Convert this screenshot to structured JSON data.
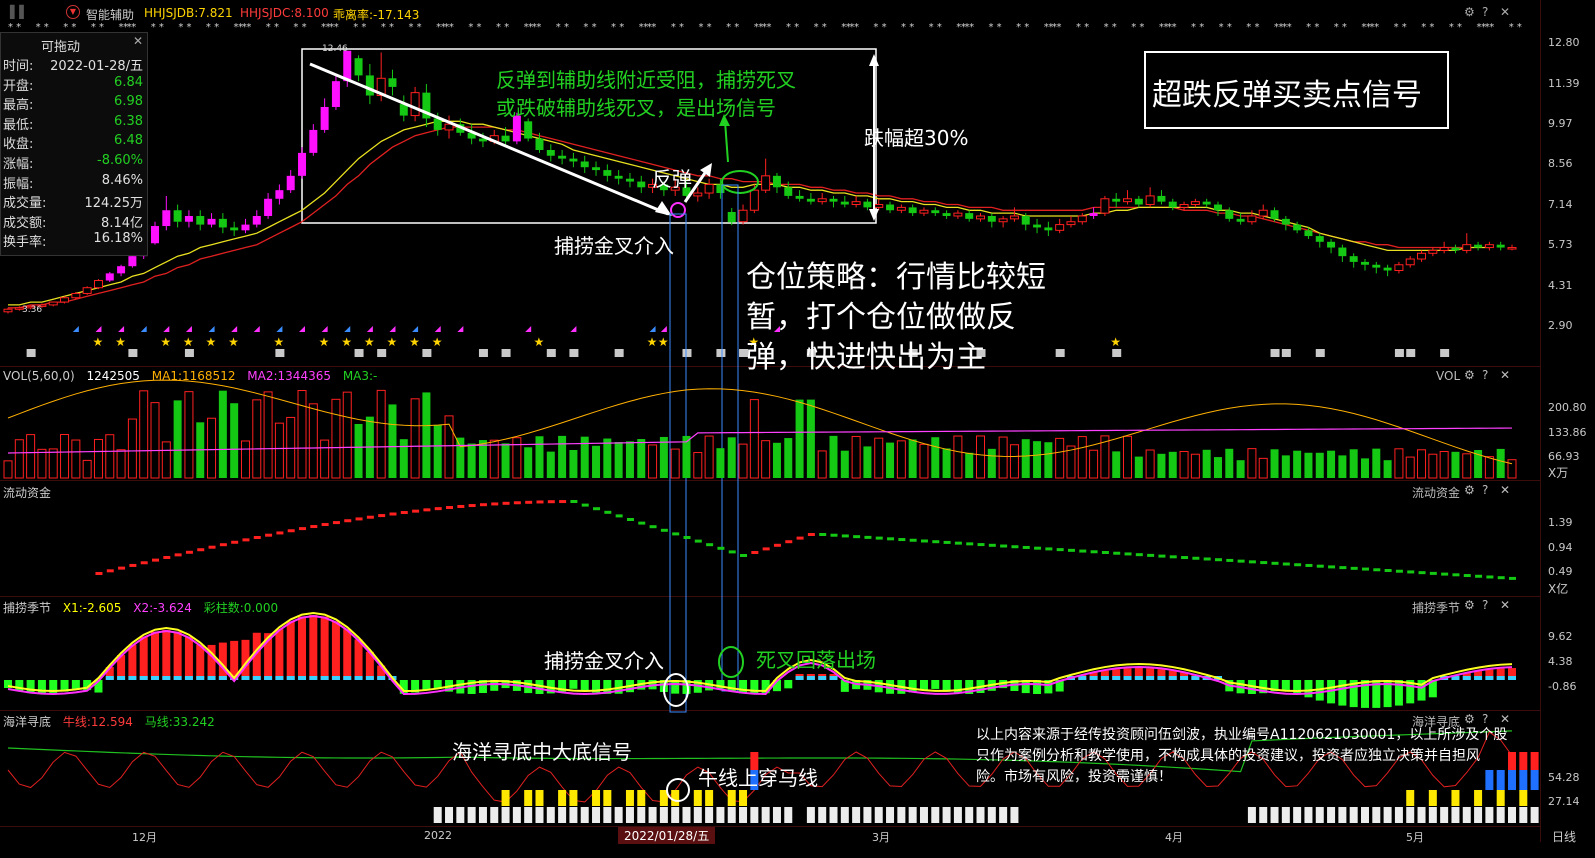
{
  "header": {
    "indicator_name": "智能辅助",
    "line1": "HHJSJDB:7.821",
    "line2": "HHJSJDC:8.100",
    "line3": "乖离率:-17.143",
    "line1_color": "#ffd400",
    "line2_color": "#ff3b3b",
    "line3_color": "#ffd400"
  },
  "info_panel": {
    "title": "可拖动",
    "rows": [
      {
        "label": "时间:",
        "value": "2022-01-28/五",
        "color": "#e0e0e0"
      },
      {
        "label": "开盘:",
        "value": "6.84",
        "color": "#22d022"
      },
      {
        "label": "最高:",
        "value": "6.98",
        "color": "#22d022"
      },
      {
        "label": "最低:",
        "value": "6.38",
        "color": "#22d022"
      },
      {
        "label": "收盘:",
        "value": "6.48",
        "color": "#22d022"
      },
      {
        "label": "涨幅:",
        "value": "-8.60%",
        "color": "#22d022"
      },
      {
        "label": "振幅:",
        "value": "8.46%",
        "color": "#e0e0e0"
      },
      {
        "label": "成交量:",
        "value": "124.25万",
        "color": "#e0e0e0"
      },
      {
        "label": "成交额:",
        "value": "8.14亿",
        "color": "#e0e0e0"
      },
      {
        "label": "换手率:",
        "value": "16.18%",
        "color": "#e0e0e0"
      }
    ]
  },
  "price_axis": [
    "12.80",
    "11.39",
    "9.97",
    "8.56",
    "7.14",
    "5.73",
    "4.31",
    "2.90"
  ],
  "price_marks": {
    "high_label": "12.46",
    "low_label": "3.36"
  },
  "volume_panel": {
    "name": "VOL(5,60,0)",
    "vol": "1242505",
    "ma1": "MA1:1168512",
    "ma2": "MA2:1344365",
    "ma3": "MA3:-",
    "right_title": "VOL",
    "axis": [
      "200.80",
      "133.86",
      "66.93"
    ],
    "unit": "X万"
  },
  "flow_panel": {
    "name": "流动资金",
    "right_title": "流动资金",
    "axis": [
      "1.39",
      "0.94",
      "0.49"
    ],
    "unit": "X亿"
  },
  "catch_panel": {
    "name": "捕捞季节",
    "x1": "X1:-2.605",
    "x2": "X2:-3.624",
    "bars": "彩柱数:0.000",
    "right_title": "捕捞季节",
    "axis": [
      "9.62",
      "4.38",
      "-0.86"
    ]
  },
  "ocean_panel": {
    "name": "海洋寻底",
    "bull": "牛线:12.594",
    "horse": "马线:33.242",
    "right_title": "海洋寻底",
    "axis": [
      "54.28",
      "27.14"
    ]
  },
  "x_axis": {
    "labels": [
      "12月",
      "2022",
      "3月",
      "4月",
      "5月"
    ],
    "cursor_label": "2022/01/28/五",
    "period": "日线"
  },
  "annotations": {
    "title_box": "超跌反弹买卖点信号",
    "resist_line1": "反弹到辅助线附近受阻，捕捞死叉",
    "resist_line2": "或跌破辅助线死叉，是出场信号",
    "drop": "跌幅超30%",
    "rebound": "反弹",
    "enter_main": "捕捞金叉介入",
    "strategy_line1": "仓位策略：行情比较短",
    "strategy_line2": "暂，打个仓位做做反",
    "strategy_line3": "弹，快进快出为主",
    "enter_catch": "捕捞金叉介入",
    "exit_catch": "死叉回落出场",
    "ocean_signal": "海洋寻底中大底信号",
    "bull_cross": "牛线上穿马线",
    "disclaimer_line1": "以上内容来源于经传投资顾问伍剑波，执业编号A1120621030001，以上所涉及个股",
    "disclaimer_line2": "只作为案例分析和教学使用，不构成具体的投资建议，投资者应独立决策并自担风",
    "disclaimer_line3": "险。市场有风险，投资需谨慎！"
  },
  "icons": [
    "settings-icon",
    "help-icon",
    "close-icon"
  ],
  "chart_data": {
    "type": "candlestick",
    "y_range": [
      2.9,
      12.8
    ],
    "candles": [
      {
        "o": 3.36,
        "c": 3.45,
        "h": 3.5,
        "l": 3.3
      },
      {
        "o": 3.45,
        "c": 3.5,
        "h": 3.55,
        "l": 3.4
      },
      {
        "o": 3.5,
        "c": 3.55,
        "h": 3.6,
        "l": 3.45
      },
      {
        "o": 3.55,
        "c": 3.6,
        "h": 3.65,
        "l": 3.5
      },
      {
        "o": 3.6,
        "c": 3.7,
        "h": 3.72,
        "l": 3.55
      },
      {
        "o": 3.7,
        "c": 3.85,
        "h": 3.9,
        "l": 3.65
      },
      {
        "o": 3.85,
        "c": 4.0,
        "h": 4.05,
        "l": 3.8
      },
      {
        "o": 4.0,
        "c": 4.2,
        "h": 4.25,
        "l": 3.95
      },
      {
        "o": 4.2,
        "c": 4.45,
        "h": 4.5,
        "l": 4.15
      },
      {
        "o": 4.45,
        "c": 4.7,
        "h": 4.75,
        "l": 4.4
      },
      {
        "o": 4.7,
        "c": 4.95,
        "h": 5.0,
        "l": 4.6
      },
      {
        "o": 4.95,
        "c": 5.3,
        "h": 5.4,
        "l": 4.9
      },
      {
        "o": 5.3,
        "c": 5.75,
        "h": 5.9,
        "l": 5.2
      },
      {
        "o": 5.75,
        "c": 6.35,
        "h": 6.5,
        "l": 5.7
      },
      {
        "o": 6.35,
        "c": 6.9,
        "h": 7.4,
        "l": 6.2
      },
      {
        "o": 6.9,
        "c": 6.5,
        "h": 7.1,
        "l": 6.3
      },
      {
        "o": 6.5,
        "c": 6.7,
        "h": 6.9,
        "l": 6.3
      },
      {
        "o": 6.7,
        "c": 6.4,
        "h": 6.9,
        "l": 6.2
      },
      {
        "o": 6.4,
        "c": 6.6,
        "h": 6.8,
        "l": 6.3
      },
      {
        "o": 6.6,
        "c": 6.3,
        "h": 6.8,
        "l": 6.1
      },
      {
        "o": 6.3,
        "c": 6.2,
        "h": 6.5,
        "l": 6.0
      },
      {
        "o": 6.2,
        "c": 6.4,
        "h": 6.6,
        "l": 6.1
      },
      {
        "o": 6.4,
        "c": 6.7,
        "h": 6.9,
        "l": 6.3
      },
      {
        "o": 6.7,
        "c": 7.3,
        "h": 7.5,
        "l": 6.6
      },
      {
        "o": 7.3,
        "c": 7.6,
        "h": 7.8,
        "l": 7.1
      },
      {
        "o": 7.6,
        "c": 8.1,
        "h": 8.3,
        "l": 7.5
      },
      {
        "o": 8.1,
        "c": 8.9,
        "h": 9.1,
        "l": 8.0
      },
      {
        "o": 8.9,
        "c": 9.7,
        "h": 9.9,
        "l": 8.8
      },
      {
        "o": 9.7,
        "c": 10.5,
        "h": 10.8,
        "l": 9.6
      },
      {
        "o": 10.5,
        "c": 11.4,
        "h": 11.6,
        "l": 10.4
      },
      {
        "o": 11.4,
        "c": 12.46,
        "h": 12.46,
        "l": 11.2
      },
      {
        "o": 12.2,
        "c": 11.6,
        "h": 12.3,
        "l": 11.4
      },
      {
        "o": 11.6,
        "c": 10.9,
        "h": 12.0,
        "l": 10.6
      },
      {
        "o": 10.9,
        "c": 11.5,
        "h": 12.4,
        "l": 10.7
      },
      {
        "o": 11.5,
        "c": 11.2,
        "h": 11.8,
        "l": 10.9
      },
      {
        "o": 10.6,
        "c": 10.2,
        "h": 10.9,
        "l": 10.0
      },
      {
        "o": 10.2,
        "c": 11.0,
        "h": 11.2,
        "l": 10.0
      },
      {
        "o": 11.0,
        "c": 10.1,
        "h": 11.3,
        "l": 9.8
      },
      {
        "o": 10.1,
        "c": 9.7,
        "h": 10.3,
        "l": 9.5
      },
      {
        "o": 9.7,
        "c": 9.9,
        "h": 10.2,
        "l": 9.4
      },
      {
        "o": 9.9,
        "c": 9.6,
        "h": 10.1,
        "l": 9.5
      },
      {
        "o": 9.6,
        "c": 9.4,
        "h": 9.9,
        "l": 9.2
      },
      {
        "o": 9.4,
        "c": 9.3,
        "h": 9.6,
        "l": 9.1
      },
      {
        "o": 9.3,
        "c": 9.5,
        "h": 9.7,
        "l": 9.2
      },
      {
        "o": 9.5,
        "c": 9.3,
        "h": 9.8,
        "l": 9.1
      },
      {
        "o": 9.3,
        "c": 10.2,
        "h": 10.3,
        "l": 9.2
      },
      {
        "o": 10.0,
        "c": 9.4,
        "h": 10.1,
        "l": 9.3
      },
      {
        "o": 9.4,
        "c": 9.0,
        "h": 9.6,
        "l": 8.9
      },
      {
        "o": 9.0,
        "c": 8.8,
        "h": 9.2,
        "l": 8.6
      },
      {
        "o": 8.8,
        "c": 8.7,
        "h": 9.0,
        "l": 8.5
      },
      {
        "o": 8.7,
        "c": 8.6,
        "h": 8.9,
        "l": 8.4
      },
      {
        "o": 8.6,
        "c": 8.4,
        "h": 8.8,
        "l": 8.2
      },
      {
        "o": 8.4,
        "c": 8.3,
        "h": 8.6,
        "l": 8.1
      },
      {
        "o": 8.3,
        "c": 8.1,
        "h": 8.5,
        "l": 7.9
      },
      {
        "o": 8.1,
        "c": 8.0,
        "h": 8.3,
        "l": 7.8
      },
      {
        "o": 8.0,
        "c": 7.9,
        "h": 8.2,
        "l": 7.7
      },
      {
        "o": 7.9,
        "c": 7.7,
        "h": 8.1,
        "l": 7.5
      },
      {
        "o": 7.7,
        "c": 7.8,
        "h": 8.0,
        "l": 7.5
      },
      {
        "o": 7.8,
        "c": 7.6,
        "h": 7.9,
        "l": 7.4
      },
      {
        "o": 7.6,
        "c": 7.7,
        "h": 8.0,
        "l": 7.4
      },
      {
        "o": 7.7,
        "c": 7.4,
        "h": 7.9,
        "l": 7.2
      },
      {
        "o": 7.4,
        "c": 7.5,
        "h": 7.7,
        "l": 7.2
      },
      {
        "o": 7.5,
        "c": 7.8,
        "h": 8.0,
        "l": 7.3
      },
      {
        "o": 7.8,
        "c": 7.5,
        "h": 8.0,
        "l": 7.3
      },
      {
        "o": 6.84,
        "c": 6.48,
        "h": 6.98,
        "l": 6.38
      },
      {
        "o": 6.5,
        "c": 6.9,
        "h": 7.1,
        "l": 6.4
      },
      {
        "o": 6.9,
        "c": 7.6,
        "h": 7.8,
        "l": 6.8
      },
      {
        "o": 7.6,
        "c": 8.1,
        "h": 8.7,
        "l": 7.5
      },
      {
        "o": 8.1,
        "c": 7.7,
        "h": 8.2,
        "l": 7.5
      },
      {
        "o": 7.7,
        "c": 7.4,
        "h": 7.9,
        "l": 7.3
      },
      {
        "o": 7.4,
        "c": 7.3,
        "h": 7.6,
        "l": 7.2
      },
      {
        "o": 7.3,
        "c": 7.2,
        "h": 7.5,
        "l": 7.1
      },
      {
        "o": 7.2,
        "c": 7.3,
        "h": 7.5,
        "l": 7.1
      },
      {
        "o": 7.3,
        "c": 7.2,
        "h": 7.4,
        "l": 7.0
      },
      {
        "o": 7.2,
        "c": 7.1,
        "h": 7.4,
        "l": 7.0
      },
      {
        "o": 7.1,
        "c": 7.2,
        "h": 7.4,
        "l": 7.0
      },
      {
        "o": 7.2,
        "c": 7.0,
        "h": 7.3,
        "l": 6.9
      },
      {
        "o": 7.0,
        "c": 7.1,
        "h": 7.3,
        "l": 6.9
      },
      {
        "o": 7.1,
        "c": 6.9,
        "h": 7.2,
        "l": 6.8
      },
      {
        "o": 6.9,
        "c": 7.0,
        "h": 7.1,
        "l": 6.8
      },
      {
        "o": 7.0,
        "c": 6.8,
        "h": 7.1,
        "l": 6.7
      },
      {
        "o": 6.8,
        "c": 6.9,
        "h": 7.0,
        "l": 6.7
      },
      {
        "o": 6.9,
        "c": 6.8,
        "h": 7.0,
        "l": 6.7
      },
      {
        "o": 6.8,
        "c": 6.7,
        "h": 6.9,
        "l": 6.6
      },
      {
        "o": 6.7,
        "c": 6.8,
        "h": 6.9,
        "l": 6.6
      },
      {
        "o": 6.8,
        "c": 6.6,
        "h": 6.9,
        "l": 6.5
      },
      {
        "o": 6.6,
        "c": 6.7,
        "h": 6.8,
        "l": 6.5
      },
      {
        "o": 6.7,
        "c": 6.5,
        "h": 6.8,
        "l": 6.3
      },
      {
        "o": 6.5,
        "c": 6.6,
        "h": 6.7,
        "l": 6.3
      },
      {
        "o": 6.6,
        "c": 6.7,
        "h": 7.0,
        "l": 6.5
      },
      {
        "o": 6.7,
        "c": 6.4,
        "h": 6.8,
        "l": 6.2
      },
      {
        "o": 6.4,
        "c": 6.3,
        "h": 6.6,
        "l": 6.1
      },
      {
        "o": 6.3,
        "c": 6.2,
        "h": 6.5,
        "l": 6.0
      },
      {
        "o": 6.2,
        "c": 6.4,
        "h": 6.6,
        "l": 6.1
      },
      {
        "o": 6.4,
        "c": 6.5,
        "h": 6.7,
        "l": 6.3
      },
      {
        "o": 6.5,
        "c": 6.7,
        "h": 6.8,
        "l": 6.4
      },
      {
        "o": 6.7,
        "c": 6.8,
        "h": 7.0,
        "l": 6.6
      },
      {
        "o": 6.8,
        "c": 7.3,
        "h": 7.4,
        "l": 6.7
      },
      {
        "o": 7.3,
        "c": 7.2,
        "h": 7.5,
        "l": 7.0
      },
      {
        "o": 7.2,
        "c": 7.3,
        "h": 7.6,
        "l": 7.1
      },
      {
        "o": 7.3,
        "c": 7.1,
        "h": 7.4,
        "l": 7.0
      },
      {
        "o": 7.1,
        "c": 7.4,
        "h": 7.7,
        "l": 7.0
      },
      {
        "o": 7.4,
        "c": 7.2,
        "h": 7.6,
        "l": 7.1
      },
      {
        "o": 7.2,
        "c": 7.0,
        "h": 7.3,
        "l": 6.9
      },
      {
        "o": 7.0,
        "c": 7.1,
        "h": 7.2,
        "l": 6.9
      },
      {
        "o": 7.1,
        "c": 7.2,
        "h": 7.3,
        "l": 7.0
      },
      {
        "o": 7.2,
        "c": 7.1,
        "h": 7.3,
        "l": 7.0
      },
      {
        "o": 7.1,
        "c": 6.9,
        "h": 7.2,
        "l": 6.7
      },
      {
        "o": 6.9,
        "c": 6.6,
        "h": 7.0,
        "l": 6.5
      },
      {
        "o": 6.6,
        "c": 6.5,
        "h": 6.8,
        "l": 6.4
      },
      {
        "o": 6.5,
        "c": 6.7,
        "h": 6.9,
        "l": 6.4
      },
      {
        "o": 6.7,
        "c": 6.9,
        "h": 7.1,
        "l": 6.6
      },
      {
        "o": 6.9,
        "c": 6.6,
        "h": 7.0,
        "l": 6.5
      },
      {
        "o": 6.6,
        "c": 6.4,
        "h": 6.7,
        "l": 6.2
      },
      {
        "o": 6.4,
        "c": 6.2,
        "h": 6.5,
        "l": 6.1
      },
      {
        "o": 6.2,
        "c": 6.0,
        "h": 6.3,
        "l": 5.9
      },
      {
        "o": 6.0,
        "c": 5.8,
        "h": 6.1,
        "l": 5.6
      },
      {
        "o": 5.8,
        "c": 5.6,
        "h": 5.9,
        "l": 5.4
      },
      {
        "o": 5.6,
        "c": 5.3,
        "h": 5.7,
        "l": 5.1
      },
      {
        "o": 5.3,
        "c": 5.1,
        "h": 5.4,
        "l": 4.9
      },
      {
        "o": 5.1,
        "c": 5.0,
        "h": 5.2,
        "l": 4.8
      },
      {
        "o": 5.0,
        "c": 4.9,
        "h": 5.1,
        "l": 4.7
      },
      {
        "o": 4.9,
        "c": 4.8,
        "h": 5.0,
        "l": 4.6
      },
      {
        "o": 4.8,
        "c": 5.0,
        "h": 5.1,
        "l": 4.7
      },
      {
        "o": 5.0,
        "c": 5.2,
        "h": 5.3,
        "l": 4.9
      },
      {
        "o": 5.2,
        "c": 5.4,
        "h": 5.5,
        "l": 5.1
      },
      {
        "o": 5.4,
        "c": 5.5,
        "h": 5.6,
        "l": 5.3
      },
      {
        "o": 5.5,
        "c": 5.6,
        "h": 5.8,
        "l": 5.4
      },
      {
        "o": 5.6,
        "c": 5.5,
        "h": 5.7,
        "l": 5.4
      },
      {
        "o": 5.5,
        "c": 5.7,
        "h": 6.1,
        "l": 5.4
      },
      {
        "o": 5.7,
        "c": 5.6,
        "h": 5.8,
        "l": 5.5
      },
      {
        "o": 5.6,
        "c": 5.7,
        "h": 5.8,
        "l": 5.5
      },
      {
        "o": 5.7,
        "c": 5.6,
        "h": 5.8,
        "l": 5.5
      },
      {
        "o": 5.6,
        "c": 5.6,
        "h": 5.7,
        "l": 5.5
      }
    ],
    "ma_yellow": [
      3.6,
      3.6,
      3.7,
      3.7,
      3.8,
      3.9,
      4.0,
      4.1,
      4.2,
      4.3,
      4.4,
      4.6,
      4.7,
      4.9,
      5.1,
      5.3,
      5.4,
      5.6,
      5.7,
      5.8,
      5.9,
      6.0,
      6.1,
      6.3,
      6.5,
      6.7,
      6.9,
      7.2,
      7.5,
      7.9,
      8.3,
      8.7,
      9.0,
      9.3,
      9.5,
      9.7,
      9.8,
      9.9,
      10.0,
      10.0,
      10.0,
      9.9,
      9.9,
      9.8,
      9.7,
      9.6,
      9.5,
      9.4,
      9.3,
      9.2,
      9.0,
      8.9,
      8.8,
      8.7,
      8.6,
      8.5,
      8.4,
      8.3,
      8.2,
      8.1,
      8.0,
      7.9,
      7.8,
      7.8,
      7.7,
      7.7,
      7.8,
      7.8,
      7.8,
      7.7,
      7.7,
      7.6,
      7.6,
      7.5,
      7.5,
      7.4,
      7.4,
      7.3,
      7.3,
      7.2,
      7.2,
      7.1,
      7.1,
      7.0,
      7.0,
      6.9,
      6.9,
      6.8,
      6.8,
      6.8,
      6.7,
      6.7,
      6.7,
      6.7,
      6.7,
      6.7,
      6.8,
      6.8,
      6.9,
      6.9,
      7.0,
      7.0,
      7.0,
      7.0,
      7.0,
      7.0,
      7.0,
      6.9,
      6.9,
      6.8,
      6.8,
      6.7,
      6.6,
      6.5,
      6.4,
      6.3,
      6.1,
      6.0,
      5.9,
      5.8,
      5.7,
      5.6,
      5.5,
      5.5,
      5.5,
      5.5,
      5.5,
      5.5,
      5.5,
      5.6,
      5.6,
      5.6
    ],
    "ma_red": [
      3.5,
      3.5,
      3.6,
      3.6,
      3.7,
      3.7,
      3.8,
      3.9,
      4.0,
      4.1,
      4.2,
      4.3,
      4.4,
      4.6,
      4.7,
      4.9,
      5.0,
      5.2,
      5.3,
      5.4,
      5.5,
      5.6,
      5.7,
      5.9,
      6.1,
      6.3,
      6.5,
      6.8,
      7.1,
      7.4,
      7.8,
      8.1,
      8.5,
      8.8,
      9.1,
      9.3,
      9.5,
      9.6,
      9.7,
      9.8,
      9.8,
      9.8,
      9.8,
      9.8,
      9.7,
      9.7,
      9.6,
      9.5,
      9.4,
      9.3,
      9.2,
      9.1,
      9.0,
      8.9,
      8.8,
      8.7,
      8.6,
      8.5,
      8.4,
      8.3,
      8.2,
      8.1,
      8.1,
      8.0,
      8.0,
      7.9,
      7.9,
      7.9,
      7.8,
      7.8,
      7.8,
      7.7,
      7.7,
      7.6,
      7.6,
      7.5,
      7.5,
      7.4,
      7.4,
      7.3,
      7.3,
      7.2,
      7.2,
      7.1,
      7.1,
      7.0,
      7.0,
      7.0,
      6.9,
      6.9,
      6.9,
      6.9,
      6.9,
      6.9,
      6.9,
      6.9,
      7.0,
      7.0,
      7.0,
      7.0,
      7.0,
      7.0,
      7.0,
      7.0,
      6.9,
      6.9,
      6.9,
      6.8,
      6.8,
      6.7,
      6.7,
      6.6,
      6.5,
      6.4,
      6.3,
      6.2,
      6.1,
      6.0,
      5.9,
      5.8,
      5.8,
      5.7,
      5.7,
      5.6,
      5.6,
      5.6,
      5.6,
      5.6,
      5.6,
      5.6
    ]
  }
}
